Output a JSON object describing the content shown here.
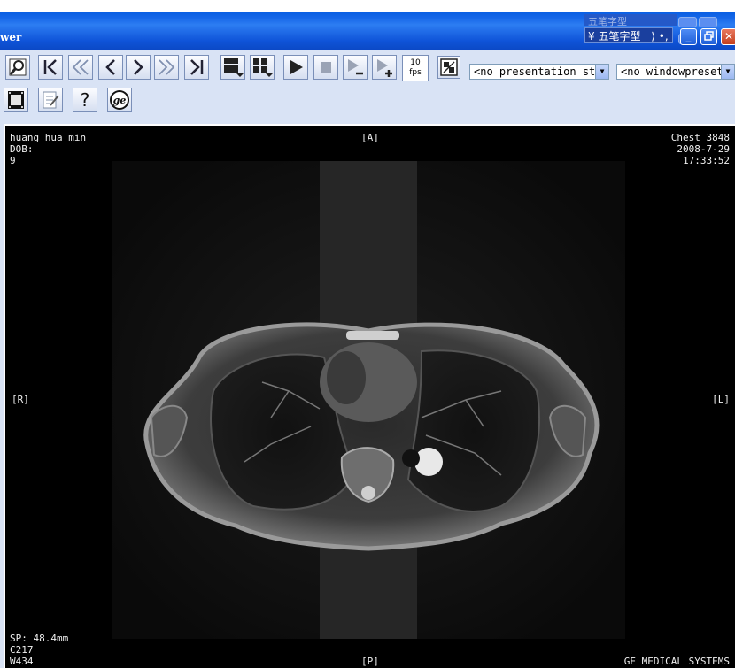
{
  "window": {
    "title": "wer",
    "ime_label": "五笔字型",
    "ime_symbols": "⟩ •,",
    "ime_ghost_label": "五笔字型"
  },
  "toolbar": {
    "fps_value": "10",
    "fps_unit": "fps",
    "presentation_state": "<no presentation st",
    "window_preset": "<no windowpreset>"
  },
  "overlay": {
    "patient_name": "huang hua min",
    "dob": "DOB:",
    "series": "9",
    "orientation_top": "[A]",
    "orientation_left": "[R]",
    "orientation_right": "[L]",
    "orientation_bottom": "[P]",
    "study": "Chest 3848",
    "date": "2008-7-29",
    "time": "17:33:52",
    "slice_position": "SP: 48.4mm",
    "window_center": "C217",
    "window_width": "W434",
    "manufacturer": "GE MEDICAL SYSTEMS"
  },
  "icons": [
    "magnifier-icon",
    "first-image-icon",
    "fast-back-icon",
    "prev-image-icon",
    "next-image-icon",
    "fast-forward-icon",
    "last-image-icon",
    "layout-rows-icon",
    "layout-grid-icon",
    "play-icon",
    "stop-icon",
    "slower-icon",
    "faster-icon",
    "sync-icon",
    "film-icon",
    "report-icon",
    "help-icon",
    "ge-logo-icon"
  ]
}
